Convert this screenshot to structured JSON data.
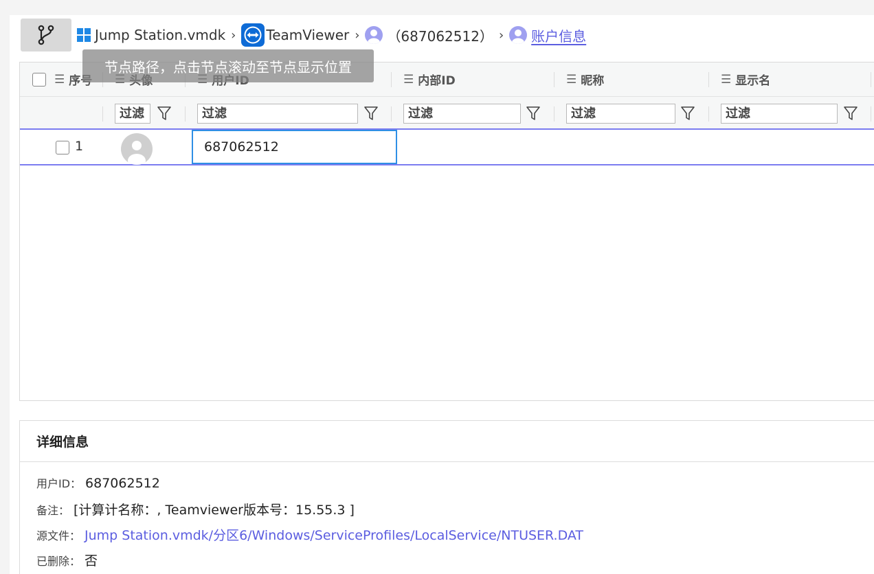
{
  "breadcrumb": {
    "items": [
      {
        "label": "Jump Station.vmdk"
      },
      {
        "label": "TeamViewer"
      },
      {
        "label": "（687062512）"
      },
      {
        "label": "账户信息"
      }
    ],
    "separator": "›",
    "tooltip": "节点路径，点击节点滚动至节点显示位置"
  },
  "grid": {
    "columns": [
      {
        "label": "序号"
      },
      {
        "label": "头像"
      },
      {
        "label": "用户ID"
      },
      {
        "label": "内部ID"
      },
      {
        "label": "昵称"
      },
      {
        "label": "显示名"
      }
    ],
    "filter_placeholder": "过滤",
    "rows": [
      {
        "index": "1",
        "user_id": "687062512"
      }
    ]
  },
  "detail": {
    "title": "详细信息",
    "fields": [
      {
        "key": "用户ID：",
        "value": "687062512"
      },
      {
        "key": "备注：",
        "value": "[计算计名称：, Teamviewer版本号：15.55.3 ]"
      },
      {
        "key": "源文件：",
        "value": "Jump Station.vmdk/分区6/Windows/ServiceProfiles/LocalService/NTUSER.DAT"
      },
      {
        "key": "已删除：",
        "value": "否"
      }
    ]
  },
  "colors": {
    "accent": "#5b5de0",
    "selection": "#2f8fe5",
    "windows_blue": "#1e88e5",
    "teamviewer_blue": "#0e6bd6"
  },
  "icons": [
    "git-branch-icon",
    "windows-icon",
    "teamviewer-icon",
    "user-icon",
    "list-icon",
    "filter-icon",
    "avatar-icon"
  ]
}
